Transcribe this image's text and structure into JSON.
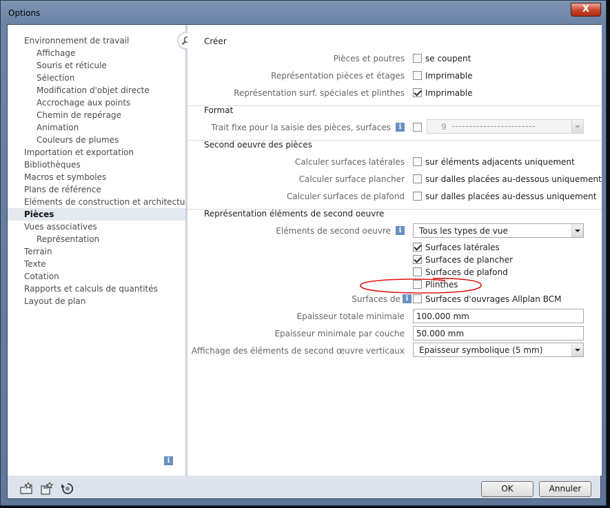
{
  "window": {
    "title": "Options",
    "close_label": "X"
  },
  "nav": {
    "items": [
      {
        "label": "Environnement de travail",
        "level": 0
      },
      {
        "label": "Affichage",
        "level": 1
      },
      {
        "label": "Souris et réticule",
        "level": 1
      },
      {
        "label": "Sélection",
        "level": 1
      },
      {
        "label": "Modification d'objet directe",
        "level": 1
      },
      {
        "label": "Accrochage aux points",
        "level": 1
      },
      {
        "label": "Chemin de repérage",
        "level": 1
      },
      {
        "label": "Animation",
        "level": 1
      },
      {
        "label": "Couleurs de plumes",
        "level": 1
      },
      {
        "label": "Importation et exportation",
        "level": 0
      },
      {
        "label": "Bibliothèques",
        "level": 0
      },
      {
        "label": "Macros et symboles",
        "level": 0
      },
      {
        "label": "Plans de référence",
        "level": 0
      },
      {
        "label": "Eléments de construction et architecture",
        "level": 0
      },
      {
        "label": "Pièces",
        "level": 0,
        "selected": true
      },
      {
        "label": "Vues associatives",
        "level": 0
      },
      {
        "label": "Représentation",
        "level": 1
      },
      {
        "label": "Terrain",
        "level": 0
      },
      {
        "label": "Texte",
        "level": 0
      },
      {
        "label": "Cotation",
        "level": 0
      },
      {
        "label": "Rapports et calculs de quantités",
        "level": 0
      },
      {
        "label": "Layout de plan",
        "level": 0
      }
    ],
    "info_glyph": "i"
  },
  "sections": {
    "creer": {
      "title": "Créer",
      "rows": [
        {
          "label": "Pièces et poutres",
          "option": "se coupent",
          "checked": false
        },
        {
          "label": "Représentation pièces et étages",
          "option": "Imprimable",
          "checked": false
        },
        {
          "label": "Représentation surf. spéciales et plinthes",
          "option": "Imprimable",
          "checked": true
        }
      ]
    },
    "format": {
      "title": "Format",
      "trait_label": "Trait fixe pour la saisie des pièces, surfaces",
      "trait_checked": false,
      "trait_value": "9"
    },
    "second_oeuvre": {
      "title": "Second oeuvre des pièces",
      "rows": [
        {
          "label": "Calculer surfaces latérales",
          "option": "sur éléments adjacents uniquement",
          "checked": false
        },
        {
          "label": "Calculer surface plancher",
          "option": "sur dalles placées au-dessous uniquement",
          "checked": false
        },
        {
          "label": "Calculer surfaces de plafond",
          "option": "sur dalles placées au-dessus uniquement",
          "checked": false
        }
      ]
    },
    "representation": {
      "title": "Représentation éléments de second oeuvre",
      "elements_label": "Eléments de second oeuvre",
      "elements_value": "Tous les types de vue",
      "checks": [
        {
          "option": "Surfaces latérales",
          "checked": true
        },
        {
          "option": "Surfaces de plancher",
          "checked": true
        },
        {
          "option": "Surfaces de plafond",
          "checked": false
        },
        {
          "option": "Plinthes",
          "checked": false
        }
      ],
      "surfaces_label": "Surfaces de",
      "surfaces_option": "Surfaces d'ouvrages Allplan BCM",
      "surfaces_checked": false,
      "epaisseur_totale_label": "Epaisseur totale minimale",
      "epaisseur_totale_value": "100.000 mm",
      "epaisseur_couche_label": "Epaisseur minimale par couche",
      "epaisseur_couche_value": "50.000 mm",
      "affichage_label": "Affichage des éléments de second œuvre verticaux",
      "affichage_value": "Epaisseur symbolique (5 mm)"
    }
  },
  "footer": {
    "ok_label": "OK",
    "cancel_label": "Annuler"
  },
  "colors": {
    "annotation_red": "#e01010",
    "selection_bg": "#e4e8ef",
    "info_blue": "#6a8fc0"
  }
}
